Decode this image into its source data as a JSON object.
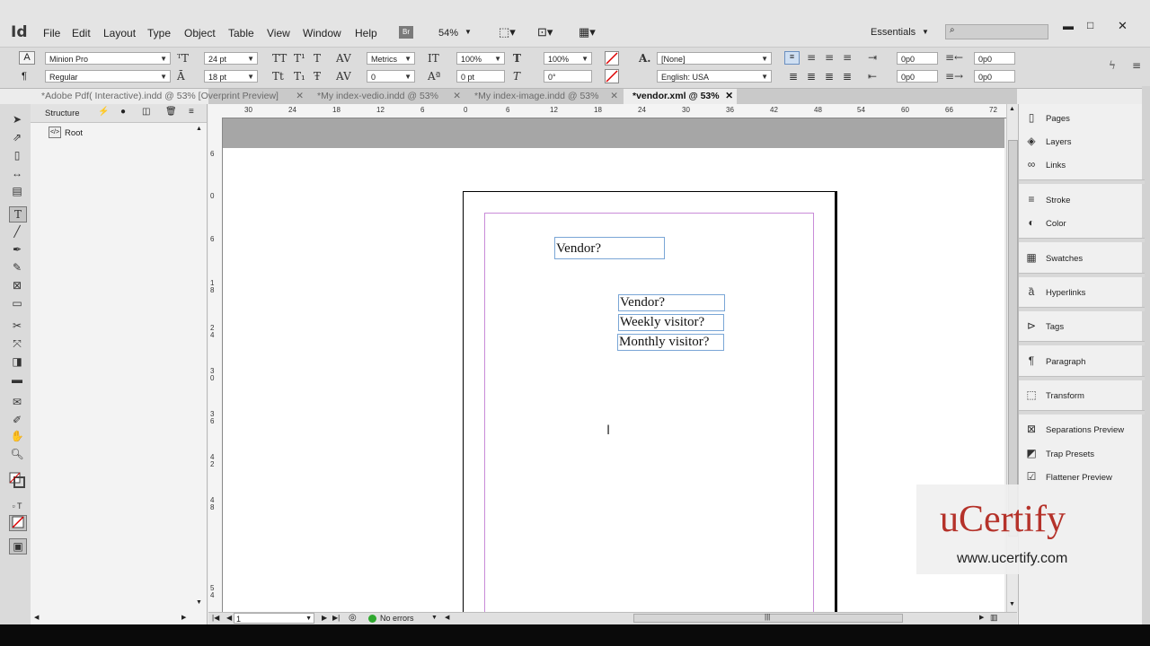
{
  "app": {
    "logo": "Id"
  },
  "menu": [
    "File",
    "Edit",
    "Layout",
    "Type",
    "Object",
    "Table",
    "View",
    "Window",
    "Help"
  ],
  "menubar": {
    "bridge": "Br",
    "zoom": "54%",
    "workspace": "Essentials"
  },
  "control": {
    "font_family": "Minion Pro",
    "font_style": "Regular",
    "font_size": "24 pt",
    "leading": "18 pt",
    "kerning": "Metrics",
    "tracking": "0",
    "v_scale": "100%",
    "h_scale": "100%",
    "baseline": "0 pt",
    "skew": "0°",
    "char_style": "[None]",
    "language": "English: USA",
    "indent_left": "0p0",
    "indent_right": "0p0",
    "indent_first": "0p0",
    "indent_last": "0p0",
    "space_before": "0p0",
    "space_after": "0p0"
  },
  "tabs": [
    {
      "label": "*Adobe Pdf( Interactive).indd @ 53% [Overprint Preview]"
    },
    {
      "label": "*My index-vedio.indd @ 53%"
    },
    {
      "label": "*My index-image.indd @ 53%"
    },
    {
      "label": "*vendor.xml @ 53%"
    }
  ],
  "structure": {
    "title": "Structure",
    "root": "Root"
  },
  "ruler_h": [
    "30",
    "24",
    "18",
    "12",
    "6",
    "0",
    "6",
    "12",
    "18",
    "24",
    "30",
    "36",
    "42",
    "48",
    "54",
    "60",
    "66",
    "72"
  ],
  "ruler_v": [
    "6",
    "0",
    "6",
    "1",
    "8",
    "2",
    "4",
    "3",
    "0",
    "3",
    "6",
    "4",
    "2",
    "4",
    "8",
    "5",
    "4"
  ],
  "frames": {
    "vendor_top": "Vendor?",
    "vendor": "Vendor?",
    "weekly": "Weekly visitor?",
    "monthly": "Monthly visitor?"
  },
  "status": {
    "page": "1",
    "errors": "No errors"
  },
  "panels": [
    {
      "label": "Pages",
      "icon": "pages-icon"
    },
    {
      "label": "Layers",
      "icon": "layers-icon"
    },
    {
      "label": "Links",
      "icon": "links-icon"
    },
    {
      "label": "Stroke",
      "icon": "stroke-icon"
    },
    {
      "label": "Color",
      "icon": "color-icon"
    },
    {
      "label": "Swatches",
      "icon": "swatches-icon"
    },
    {
      "label": "Hyperlinks",
      "icon": "hyperlinks-icon"
    },
    {
      "label": "Tags",
      "icon": "tags-icon"
    },
    {
      "label": "Paragraph",
      "icon": "paragraph-icon"
    },
    {
      "label": "Transform",
      "icon": "transform-icon"
    },
    {
      "label": "Separations Preview",
      "icon": "separations-icon"
    },
    {
      "label": "Trap Presets",
      "icon": "trap-icon"
    },
    {
      "label": "Flattener Preview",
      "icon": "flattener-icon"
    }
  ],
  "brand": {
    "name": "uCertify",
    "url": "www.ucertify.com",
    "color": "#b5322a"
  }
}
